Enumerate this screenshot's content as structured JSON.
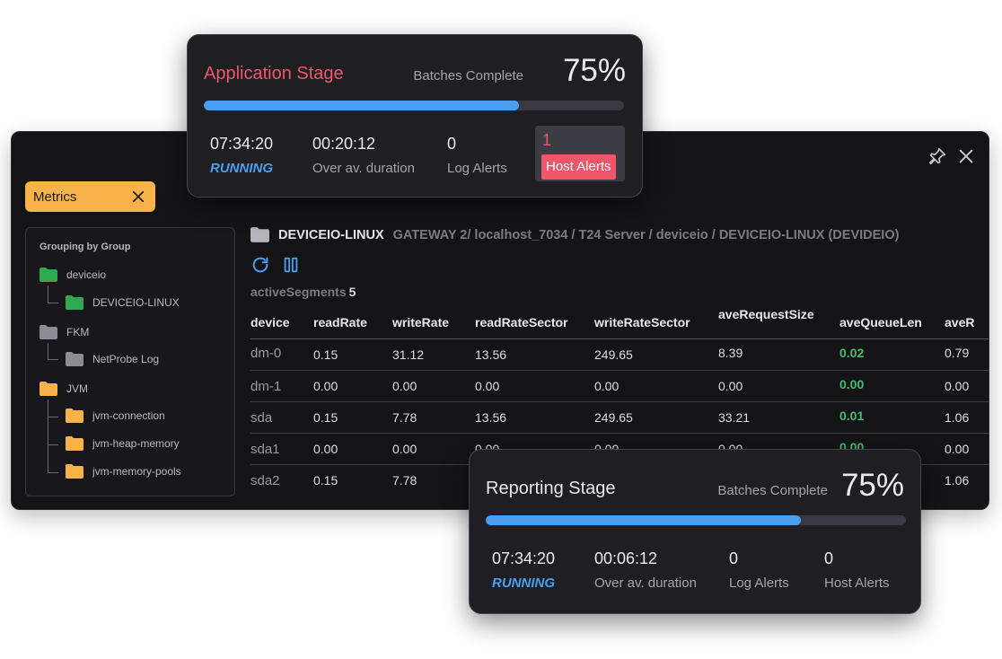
{
  "window": {
    "metrics_chip": "Metrics",
    "tree": {
      "title": "Grouping by Group",
      "nodes": [
        {
          "label": "deviceio",
          "color": "#32a852"
        },
        {
          "label": "DEVICEIO-LINUX",
          "color": "#32a852"
        },
        {
          "label": "FKM",
          "color": "#8c8c94"
        },
        {
          "label": "NetProbe Log",
          "color": "#8c8c94"
        },
        {
          "label": "JVM",
          "color": "#f7b24a"
        },
        {
          "label": "jvm-connection",
          "color": "#f7b24a"
        },
        {
          "label": "jvm-heap-memory",
          "color": "#f7b24a"
        },
        {
          "label": "jvm-memory-pools",
          "color": "#f7b24a"
        }
      ]
    },
    "path": {
      "main": "DEVICEIO-LINUX",
      "rest": "GATEWAY 2/ localhost_7034 / T24 Server / deviceio / DEVICEIO-LINUX (DEVIDEIO)"
    },
    "segments": {
      "label": "activeSegments",
      "count": "5"
    },
    "table": {
      "headers": [
        "device",
        "readRate",
        "writeRate",
        "readRateSector",
        "writeRateSector",
        "aveRequestSize",
        "aveQueueLen",
        "aveR"
      ],
      "rows": [
        [
          "dm-0",
          "0.15",
          "31.12",
          "13.56",
          "249.65",
          "8.39",
          "0.02",
          "0.79"
        ],
        [
          "dm-1",
          "0.00",
          "0.00",
          "0.00",
          "0.00",
          "0.00",
          "0.00",
          "0.00"
        ],
        [
          "sda",
          "0.15",
          "7.78",
          "13.56",
          "249.65",
          "33.21",
          "0.01",
          "1.06"
        ],
        [
          "sda1",
          "0.00",
          "0.00",
          "0.00",
          "0.00",
          "0.00",
          "0.00",
          "0.00"
        ],
        [
          "sda2",
          "0.15",
          "7.78",
          "",
          "",
          "",
          "",
          "1.06"
        ]
      ]
    }
  },
  "application_stage": {
    "title": "Application Stage",
    "batches_label": "Batches Complete",
    "percent": "75%",
    "progress": 0.75,
    "time": "07:34:20",
    "status": "RUNNING",
    "duration": "00:20:12",
    "duration_label": "Over av. duration",
    "log_alerts": "0",
    "log_alerts_label": "Log Alerts",
    "host_alerts": "1",
    "host_alerts_label": "Host Alerts"
  },
  "reporting_stage": {
    "title": "Reporting Stage",
    "batches_label": "Batches Complete",
    "percent": "75%",
    "progress": 0.75,
    "time": "07:34:20",
    "status": "RUNNING",
    "duration": "00:06:12",
    "duration_label": "Over av. duration",
    "log_alerts": "0",
    "log_alerts_label": "Log Alerts",
    "host_alerts": "0",
    "host_alerts_label": "Host Alerts"
  },
  "colors": {
    "accent": "#4a9ef0",
    "alert": "#f0566a",
    "metrics": "#f7b24a",
    "ok": "#3fc06f"
  }
}
